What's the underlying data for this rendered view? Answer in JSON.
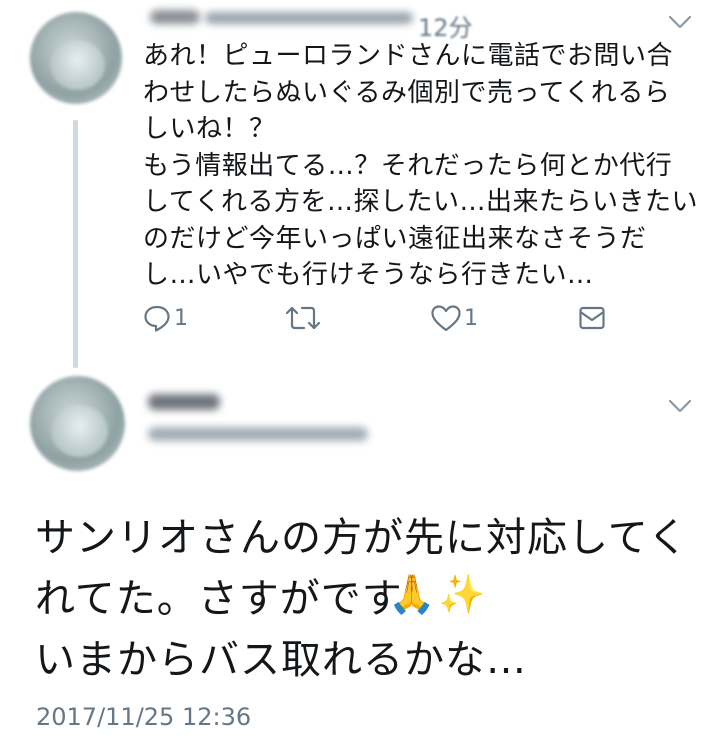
{
  "reply_tweet": {
    "time_ago": "12分",
    "text": "あれ！ピューロランドさんに電話でお問い合\nわせしたらぬいぐるみ個別で売ってくれるら\nしいね！？\nもう情報出てる…？それだったら何とか代行\nしてくれる方を…探したい…出来たらいきたい\nのだけど今年いっぱい遠征出来なさそうだ\nし…いやでも行けそうなら行きたい…",
    "reply_count": "1",
    "like_count": "1"
  },
  "main_tweet": {
    "text": "サンリオさんの方が先に対応してく\nれてた。さすがです\nいまからバス取れるかな…",
    "emoji_hands": "🙏",
    "emoji_sparkles": "✨",
    "timestamp": "2017/11/25 12:36"
  },
  "icons": {
    "reply": "reply-icon",
    "retweet": "retweet-icon",
    "like": "heart-icon",
    "dm": "envelope-icon",
    "more": "chevron-down-icon"
  },
  "colors": {
    "text": "#14171a",
    "muted": "#657786",
    "thread_line": "#cfd9de"
  }
}
